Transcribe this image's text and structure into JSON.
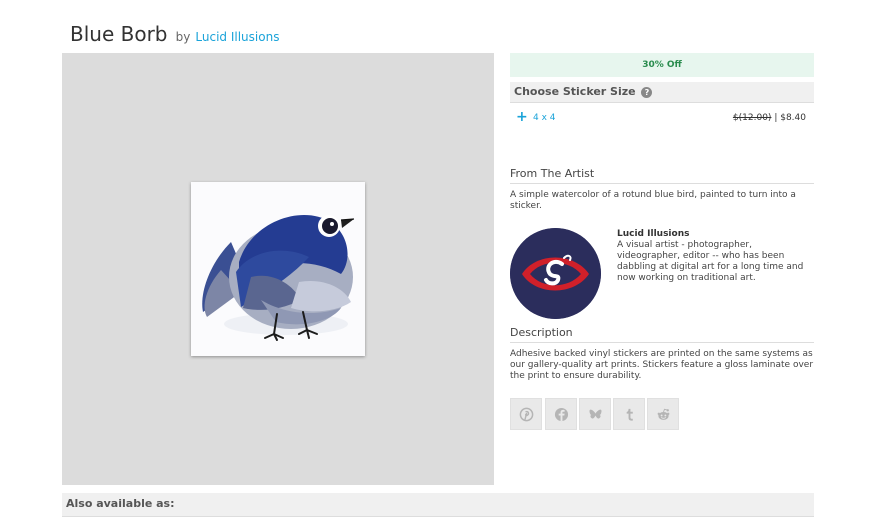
{
  "product": {
    "title": "Blue Borb",
    "by_label": "by",
    "artist_name": "Lucid Illusions"
  },
  "pricing": {
    "discount_label": "30% Off"
  },
  "size": {
    "header": "Choose Sticker Size",
    "help_glyph": "?",
    "option": {
      "icon": "plus-icon",
      "label": "4 x 4",
      "original_price": "$(12.00)",
      "separator": "|",
      "sale_price": "$8.40"
    }
  },
  "from_artist": {
    "heading": "From The Artist",
    "summary": "A simple watercolor of a rotund blue bird, painted to turn into a sticker.",
    "artist_name": "Lucid Illusions",
    "bio": "A visual artist - photographer, videographer, editor -- who has been dabbling at digital art for a long time and now working on traditional art."
  },
  "description": {
    "heading": "Description",
    "text": "Adhesive backed vinyl stickers are printed on the same systems as our gallery-quality art prints. Stickers feature a gloss laminate over the print to ensure durability."
  },
  "share": [
    {
      "icon": "pinterest-icon"
    },
    {
      "icon": "facebook-icon"
    },
    {
      "icon": "bluesky-icon"
    },
    {
      "icon": "tumblr-icon"
    },
    {
      "icon": "reddit-icon"
    }
  ],
  "also_available": "Also available as:",
  "colors": {
    "link": "#1aa3d9",
    "discount_bg": "#e7f6ee",
    "discount_text": "#2a8c4e",
    "image_bg": "#dcdcdc",
    "avatar_bg": "#2b2d5c",
    "avatar_accent": "#d0202a"
  }
}
